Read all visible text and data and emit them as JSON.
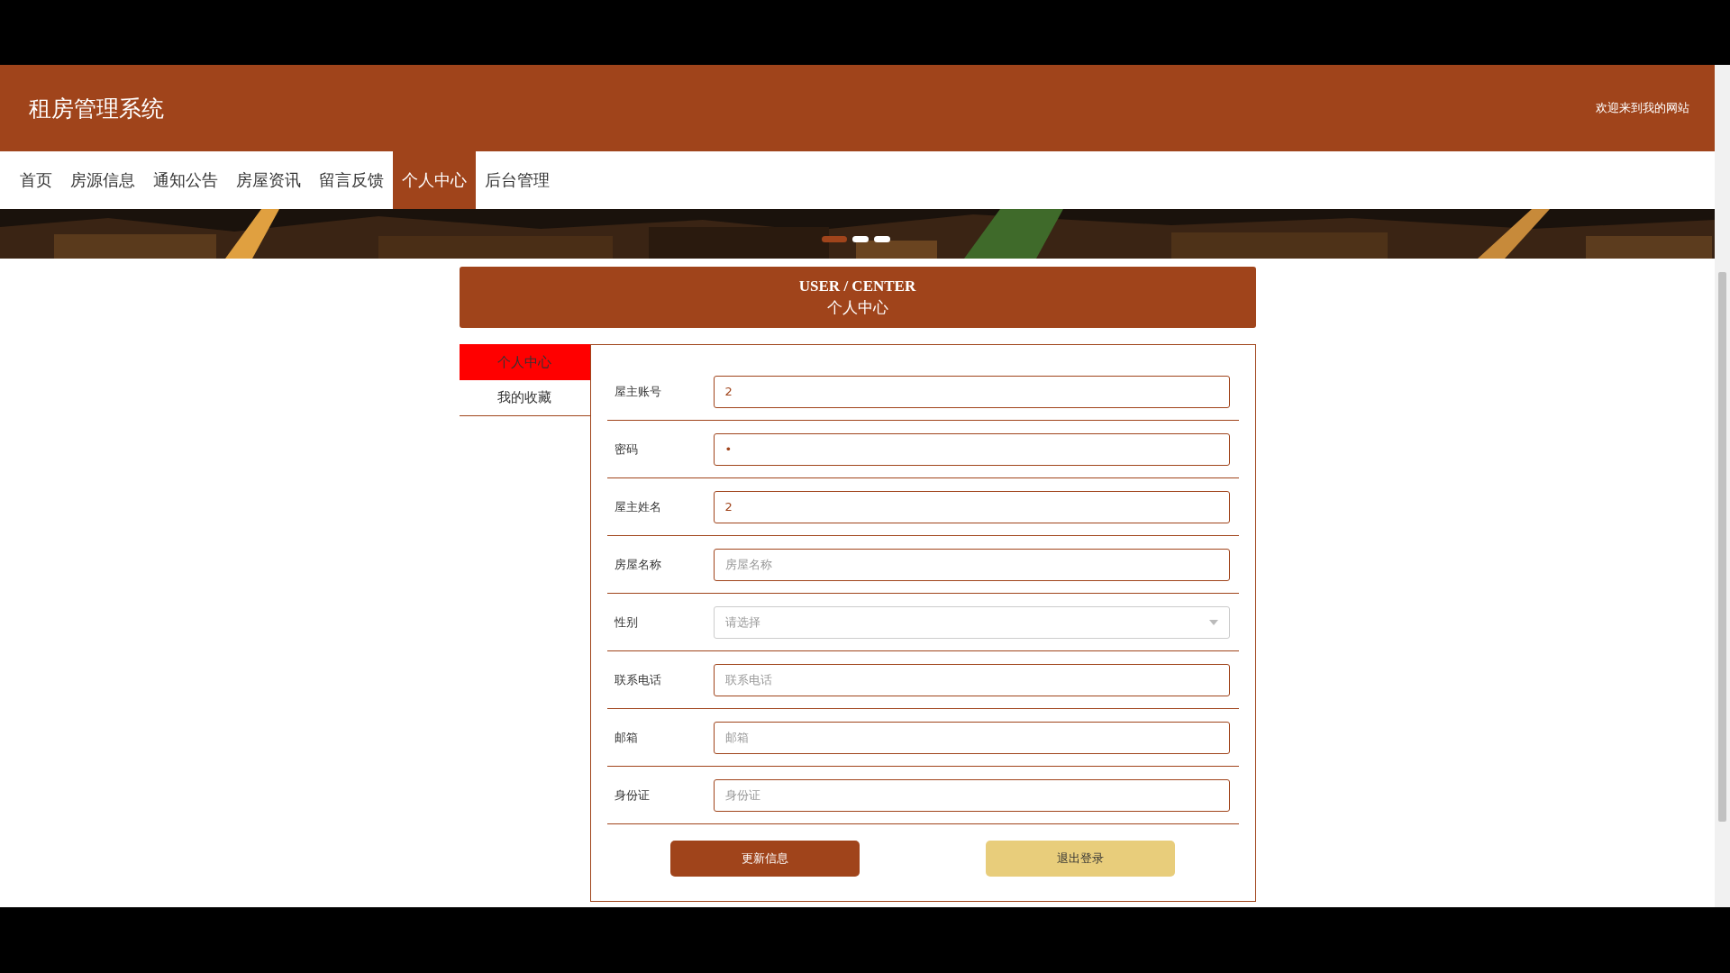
{
  "header": {
    "title": "租房管理系统",
    "welcome": "欢迎来到我的网站"
  },
  "nav": [
    {
      "label": "首页",
      "selected": false
    },
    {
      "label": "房源信息",
      "selected": false
    },
    {
      "label": "通知公告",
      "selected": false
    },
    {
      "label": "房屋资讯",
      "selected": false
    },
    {
      "label": "留言反馈",
      "selected": false
    },
    {
      "label": "个人中心",
      "selected": true
    },
    {
      "label": "后台管理",
      "selected": false
    }
  ],
  "banner": {
    "kind": "picture",
    "dots": [
      {
        "selected": true
      },
      {
        "selected": false
      },
      {
        "selected": false
      }
    ]
  },
  "section_title": {
    "english": "USER / CENTER",
    "chinese": "个人中心"
  },
  "sidebar": [
    {
      "label": "个人中心",
      "selected": true
    },
    {
      "label": "我的收藏",
      "selected": false
    }
  ],
  "form": [
    {
      "label": "屋主账号",
      "kind": "text",
      "value": "2"
    },
    {
      "label": "密码",
      "kind": "password",
      "value": "•"
    },
    {
      "label": "屋主姓名",
      "kind": "text",
      "value": "2"
    },
    {
      "label": "房屋名称",
      "kind": "text",
      "placeholder": "房屋名称"
    },
    {
      "label": "性别",
      "kind": "select",
      "placeholder": "请选择"
    },
    {
      "label": "联系电话",
      "kind": "text",
      "placeholder": "联系电话"
    },
    {
      "label": "邮箱",
      "kind": "text",
      "placeholder": "邮箱"
    },
    {
      "label": "身份证",
      "kind": "text",
      "placeholder": "身份证"
    }
  ],
  "buttons": [
    {
      "label": "更新信息",
      "kind": "primary"
    },
    {
      "label": "退出登录",
      "kind": "secondary"
    }
  ]
}
